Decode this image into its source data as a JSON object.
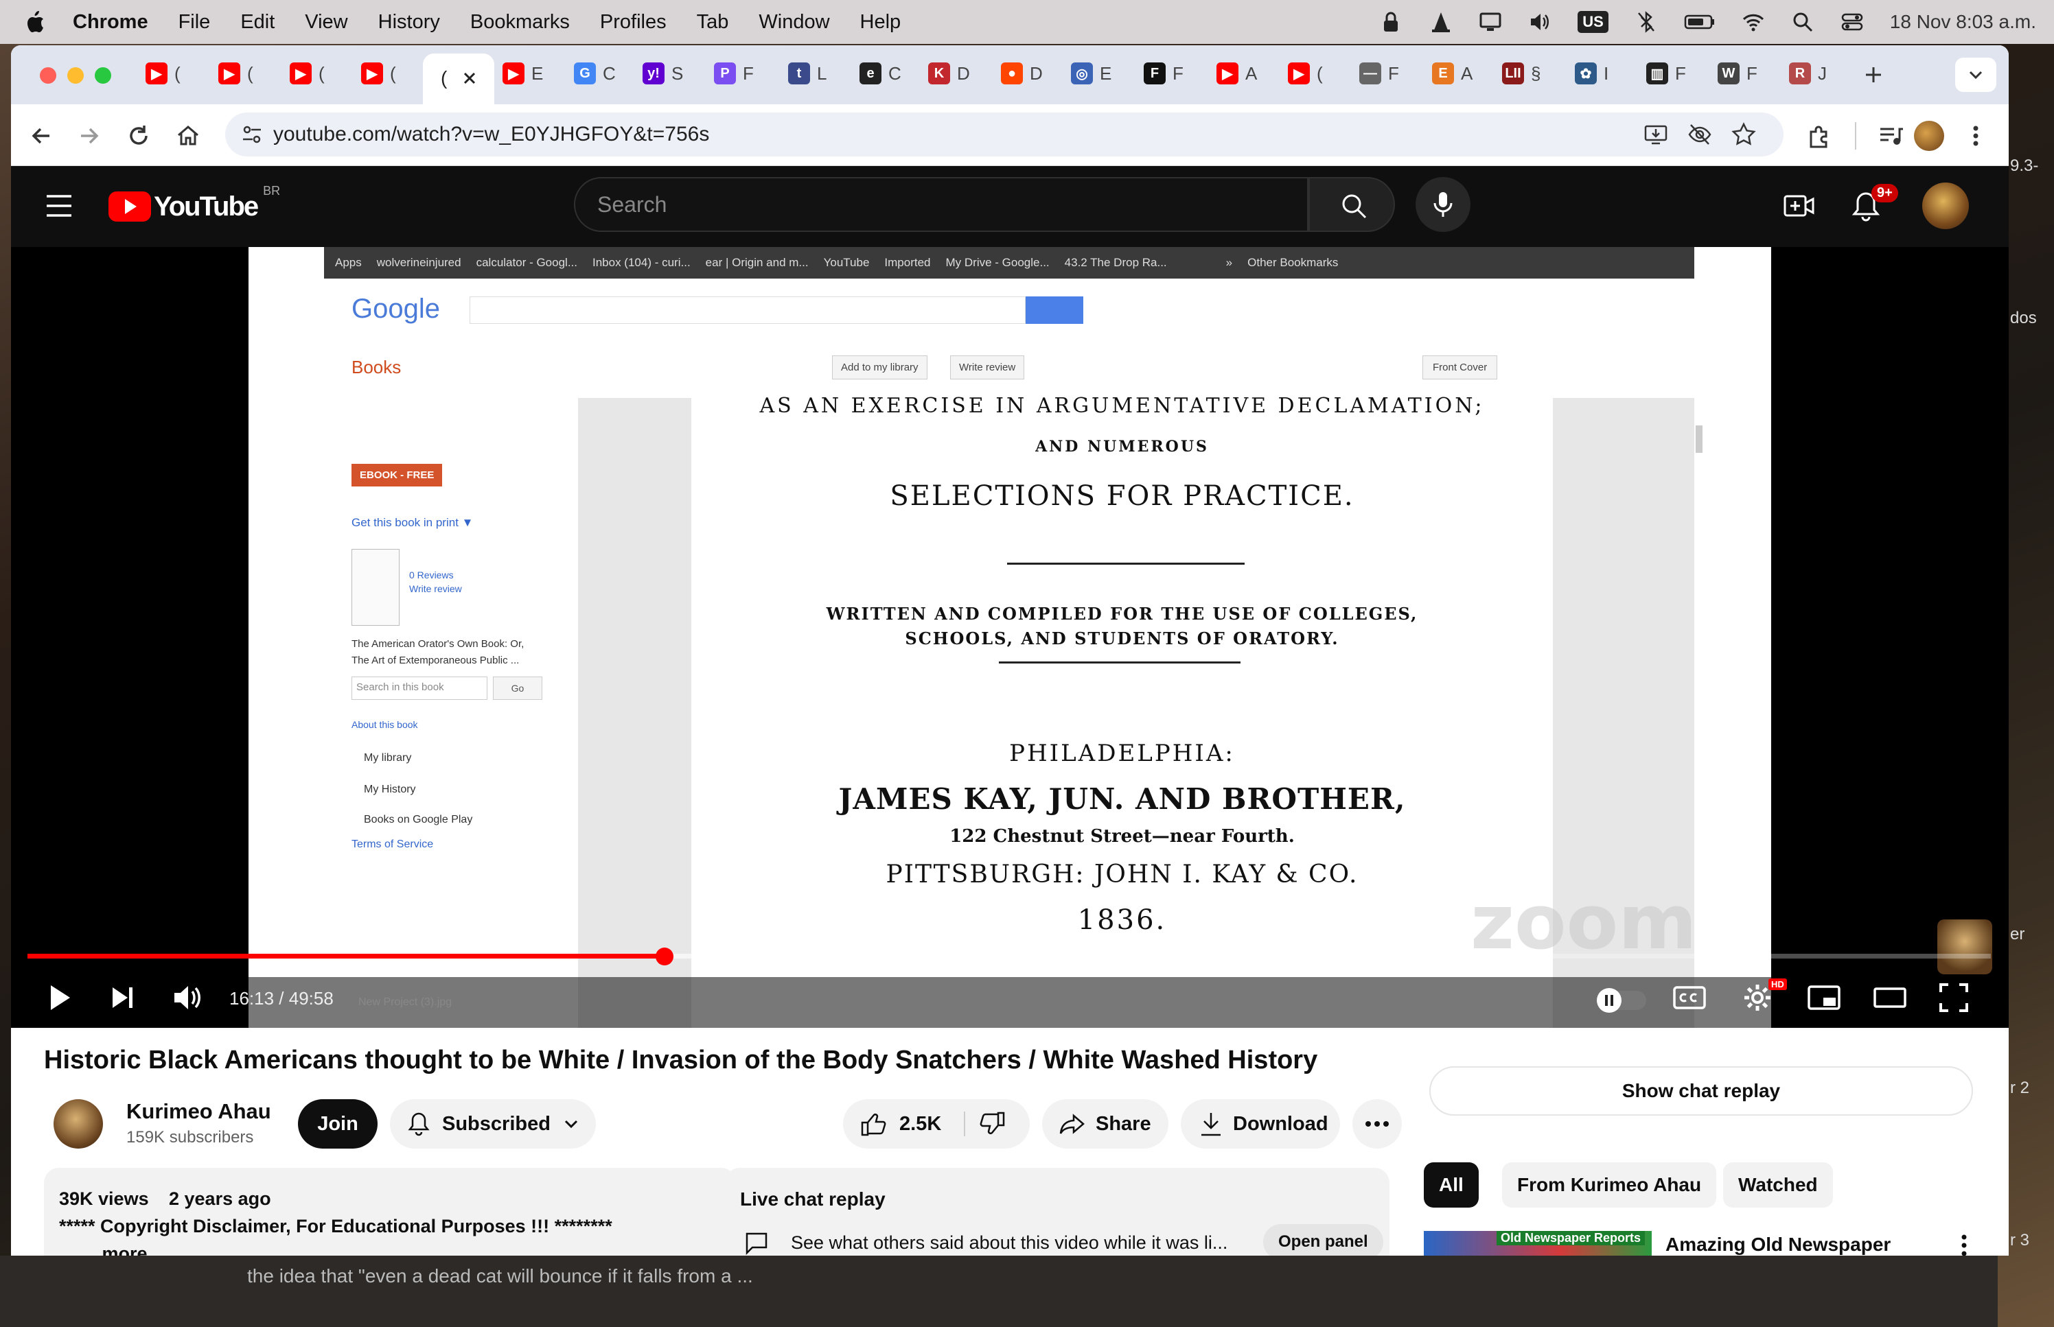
{
  "menubar": {
    "apple": "",
    "app": "Chrome",
    "items": [
      "File",
      "Edit",
      "View",
      "History",
      "Bookmarks",
      "Profiles",
      "Tab",
      "Window",
      "Help"
    ],
    "keyboard": "US",
    "datetime": "18 Nov  8:03 a.m."
  },
  "tabs": [
    {
      "color": "#ff0000",
      "glyph": "▶",
      "label": "("
    },
    {
      "color": "#ff0000",
      "glyph": "▶",
      "label": "("
    },
    {
      "color": "#ff0000",
      "glyph": "▶",
      "label": "("
    },
    {
      "color": "#ff0000",
      "glyph": "▶",
      "label": "("
    },
    {
      "color": "#ff0000",
      "glyph": "▶",
      "label": "E"
    },
    {
      "color": "#4285f4",
      "glyph": "G",
      "label": "C"
    },
    {
      "color": "#6001d2",
      "glyph": "y!",
      "label": "S"
    },
    {
      "color": "#7a4ef0",
      "glyph": "P",
      "label": "F"
    },
    {
      "color": "#3a4a8a",
      "glyph": "t",
      "label": "L"
    },
    {
      "color": "#222222",
      "glyph": "e",
      "label": "C"
    },
    {
      "color": "#c2272d",
      "glyph": "K",
      "label": "D"
    },
    {
      "color": "#ff4500",
      "glyph": "●",
      "label": "D"
    },
    {
      "color": "#3b63b6",
      "glyph": "◎",
      "label": "E"
    },
    {
      "color": "#111111",
      "glyph": "F",
      "label": "F"
    },
    {
      "color": "#ff0000",
      "glyph": "▶",
      "label": "A"
    },
    {
      "color": "#ff0000",
      "glyph": "▶",
      "label": "("
    },
    {
      "color": "#666666",
      "glyph": "—",
      "label": "F"
    },
    {
      "color": "#e87722",
      "glyph": "E",
      "label": "A"
    },
    {
      "color": "#8b1a1a",
      "glyph": "LII",
      "label": "§"
    },
    {
      "color": "#2e5a8a",
      "glyph": "✿",
      "label": "I"
    },
    {
      "color": "#222222",
      "glyph": "▥",
      "label": "F"
    },
    {
      "color": "#444444",
      "glyph": "W",
      "label": "F"
    },
    {
      "color": "#b54a4a",
      "glyph": "R",
      "label": "J"
    }
  ],
  "active_tab": {
    "label": "("
  },
  "address_bar": {
    "url": "youtube.com/watch?v=w_E0YJHGFOY&t=756s"
  },
  "youtube": {
    "logo": "YouTube",
    "region": "BR",
    "search_placeholder": "Search",
    "notification_count": "9+"
  },
  "video_content": {
    "bookmarks": [
      "Apps",
      "wolverineinjured",
      "calculator - Googl...",
      "Inbox (104) - curi...",
      "ear | Origin and m...",
      "YouTube",
      "Imported",
      "My Drive - Google...",
      "43.2 The Drop Ra...",
      "»",
      "Other Bookmarks"
    ],
    "google_logo": "Google",
    "books_label": "Books",
    "toolbar_buttons": [
      "Add to my library",
      "Write review"
    ],
    "front_cover": "Front Cover",
    "ebook_badge": "EBOOK - FREE",
    "get_print": "Get this book in print ▼",
    "reviews": "0 Reviews",
    "write_review": "Write review",
    "book_title_1": "The American Orator's Own Book: Or,",
    "book_title_2": "The Art of Extemporaneous Public ...",
    "search_in_book": "Search in this book",
    "go": "Go",
    "about": "About this book",
    "my_library": "My library",
    "my_history": "My History",
    "books_play": "Books on Google Play",
    "terms": "Terms of Service",
    "scan_top": "AS AN EXERCISE IN ARGUMENTATIVE DECLAMATION;",
    "scan_numerous": "AND NUMEROUS",
    "scan_selections": "SELECTIONS FOR PRACTICE.",
    "scan_written_1": "WRITTEN AND COMPILED FOR THE USE OF COLLEGES,",
    "scan_written_2": "SCHOOLS, AND STUDENTS OF ORATORY.",
    "scan_city": "PHILADELPHIA:",
    "scan_publisher": "JAMES KAY, JUN. AND BROTHER,",
    "scan_address": "122 Chestnut Street—near Fourth.",
    "scan_pittsburgh": "PITTSBURGH: JOHN I. KAY & CO.",
    "scan_year": "1836.",
    "zoom_watermark": "zoom",
    "taskbar_file": "New Project (3).jpg"
  },
  "player": {
    "time": "16:13 / 49:58",
    "progress_fraction": 0.3245,
    "buffered_fraction": 0.366,
    "hd_badge": "HD"
  },
  "video": {
    "title": "Historic Black Americans thought to be White / Invasion of the Body Snatchers / White Washed History",
    "channel": "Kurimeo Ahau",
    "subscribers": "159K subscribers",
    "join": "Join",
    "subscribed": "Subscribed",
    "likes": "2.5K",
    "share": "Share",
    "download": "Download",
    "views": "39K views",
    "ago": "2 years ago",
    "disclaimer": "***** Copyright Disclaimer, For Educational Purposes !!! ********",
    "more": "...more"
  },
  "live_chat": {
    "heading": "Live chat replay",
    "text": "See what others said about this video while it was li...",
    "open_panel": "Open panel",
    "show_replay": "Show chat replay"
  },
  "sidebar": {
    "chips": [
      "All",
      "From Kurimeo Ahau",
      "Watched"
    ],
    "first_video_title": "Amazing Old Newspaper",
    "thumb_caption": "Old Newspaper Reports"
  },
  "desktop": {
    "right_fragments": [
      "9.3-",
      "dos",
      "er",
      "r 2",
      "r 3"
    ],
    "bottom_text": "the idea that \"even a dead cat will bounce if it falls from a ..."
  }
}
